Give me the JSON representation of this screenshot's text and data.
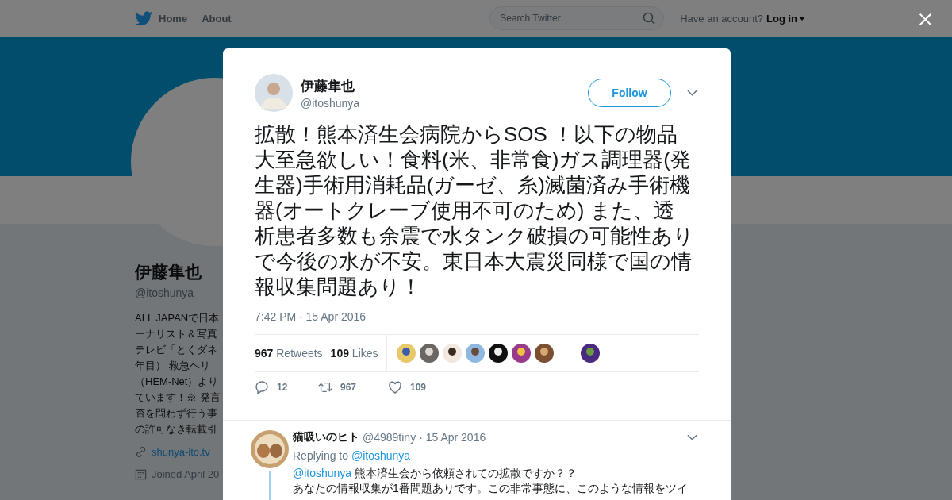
{
  "nav": {
    "home": "Home",
    "about": "About",
    "search": {
      "placeholder": "Search Twitter"
    },
    "have_account": "Have an account?",
    "login": "Log in"
  },
  "profile": {
    "name": "伊藤隼也",
    "handle": "@itoshunya",
    "bio_lines": [
      "ALL JAPANで日本",
      "ーナリスト＆写真",
      "テレビ「とくダネ",
      "年目） 救急ヘリ",
      "（HEM-Net）より",
      "ています！※ 発言",
      "否を問わず行う事",
      "の許可なき転載引"
    ],
    "website": "shunya-ito.tv",
    "joined": "Joined April 20"
  },
  "tweet": {
    "author": "伊藤隼也",
    "handle": "@itoshunya",
    "follow": "Follow",
    "text": "拡散！熊本済生会病院からSOS ！以下の物品大至急欲しい！食料(米、非常食)ガス調理器(発生器)手術用消耗品(ガーゼ、糸)滅菌済み手術機器(オートクレーブ使用不可のため) また、透析患者多数も余震で水タンク破損の可能性ありで今後の水が不安。東日本大震災同様で国の情報収集問題あり！",
    "time": "7:42 PM - 15 Apr 2016",
    "stats": [
      {
        "count": "967",
        "label": "Retweets"
      },
      {
        "count": "109",
        "label": "Likes"
      }
    ],
    "likers": [
      {
        "kind": "avatar"
      },
      {
        "kind": "avatar"
      },
      {
        "kind": "avatar"
      },
      {
        "kind": "avatar"
      },
      {
        "kind": "avatar"
      },
      {
        "kind": "avatar"
      },
      {
        "kind": "avatar"
      },
      {
        "kind": "gap"
      },
      {
        "kind": "avatar"
      }
    ],
    "actions": [
      {
        "kind": "reply",
        "count": "12"
      },
      {
        "kind": "retweet",
        "count": "967"
      },
      {
        "kind": "like",
        "count": "109"
      }
    ]
  },
  "reply": {
    "author": "猫吸いのヒト",
    "handle": "@4989tiny",
    "date": "· 15 Apr 2016",
    "replying_to": "Replying to",
    "replying_handle": "@itoshunya",
    "mention": "@itoshunya",
    "text_1": "熊本済生会から依頼されての拡散ですか？？",
    "text_2": "あなたの情報収集が1番問題ありです。この非常事態に、このような情報をツイ"
  }
}
